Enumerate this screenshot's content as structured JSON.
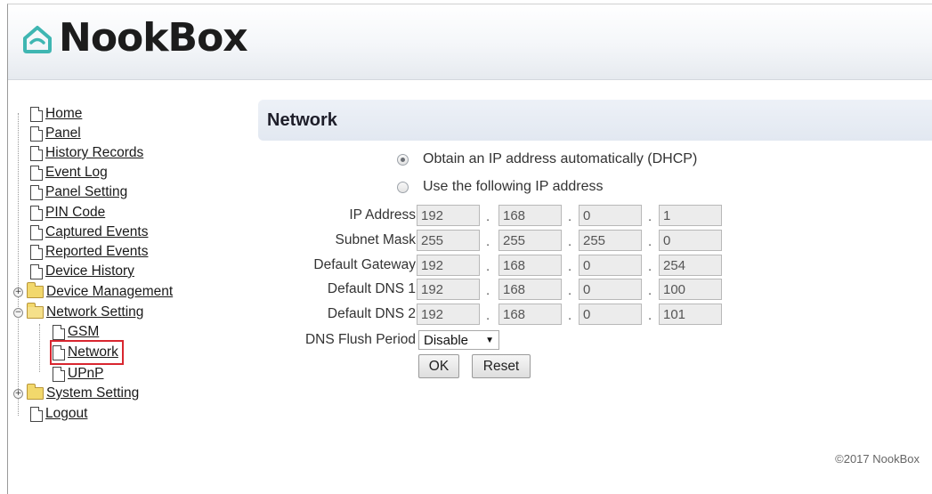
{
  "app": {
    "brand": "NookBox"
  },
  "sidebar": {
    "items": [
      {
        "label": "Home"
      },
      {
        "label": "Panel"
      },
      {
        "label": "History Records"
      },
      {
        "label": "Event Log"
      },
      {
        "label": "Panel Setting"
      },
      {
        "label": "PIN Code"
      },
      {
        "label": "Captured Events"
      },
      {
        "label": "Reported Events"
      },
      {
        "label": "Device History"
      },
      {
        "label": "Device Management",
        "expander": "+"
      },
      {
        "label": "Network Setting",
        "expander": "−",
        "children": [
          {
            "label": "GSM"
          },
          {
            "label": "Network",
            "selected": true
          },
          {
            "label": "UPnP"
          }
        ]
      },
      {
        "label": "System Setting",
        "expander": "+"
      },
      {
        "label": "Logout"
      }
    ]
  },
  "main": {
    "title": "Network",
    "dhcp_option": {
      "label": "Obtain an IP address automatically (DHCP)",
      "checked": true
    },
    "static_option": {
      "label": "Use the following IP address",
      "checked": false
    },
    "fields": [
      {
        "label": "IP Address",
        "octets": [
          "192",
          "168",
          "0",
          "1"
        ]
      },
      {
        "label": "Subnet Mask",
        "octets": [
          "255",
          "255",
          "255",
          "0"
        ]
      },
      {
        "label": "Default Gateway",
        "octets": [
          "192",
          "168",
          "0",
          "254"
        ]
      },
      {
        "label": "Default DNS 1",
        "octets": [
          "192",
          "168",
          "0",
          "100"
        ]
      },
      {
        "label": "Default DNS 2",
        "octets": [
          "192",
          "168",
          "0",
          "101"
        ]
      }
    ],
    "dns_flush": {
      "label": "DNS Flush Period",
      "value": "Disable"
    },
    "ok_label": "OK",
    "reset_label": "Reset"
  },
  "footer": {
    "copyright": "©2017 NookBox"
  }
}
